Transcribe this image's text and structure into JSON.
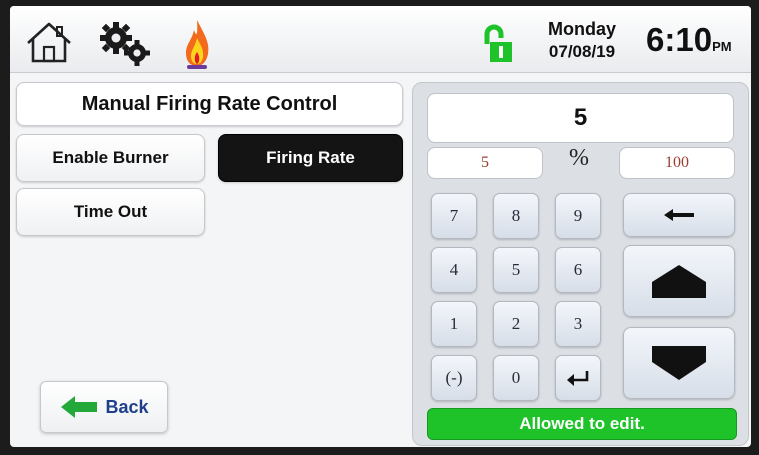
{
  "header": {
    "day": "Monday",
    "date": "07/08/19",
    "time": "6:10",
    "ampm": "PM",
    "icons": [
      "home-icon",
      "settings-gears-icon",
      "flame-icon",
      "unlocked-padlock-icon"
    ],
    "colors": {
      "lock_green": "#1ec329",
      "flame_orange": "#f26a1b"
    }
  },
  "page": {
    "title": "Manual Firing Rate Control"
  },
  "buttons": {
    "enable_burner": "Enable Burner",
    "firing_rate": "Firing Rate",
    "time_out": "Time Out",
    "back": "Back"
  },
  "keypad": {
    "display_value": "5",
    "min": "5",
    "unit": "%",
    "max": "100",
    "keys": [
      "7",
      "8",
      "9",
      "4",
      "5",
      "6",
      "1",
      "2",
      "3",
      "(-)",
      "0"
    ],
    "icons": [
      "backspace-arrow-icon",
      "enter-arrow-icon",
      "increase-triangle-icon",
      "decrease-triangle-icon"
    ]
  },
  "status": {
    "text": "Allowed to edit.",
    "color": "#1ec329"
  }
}
